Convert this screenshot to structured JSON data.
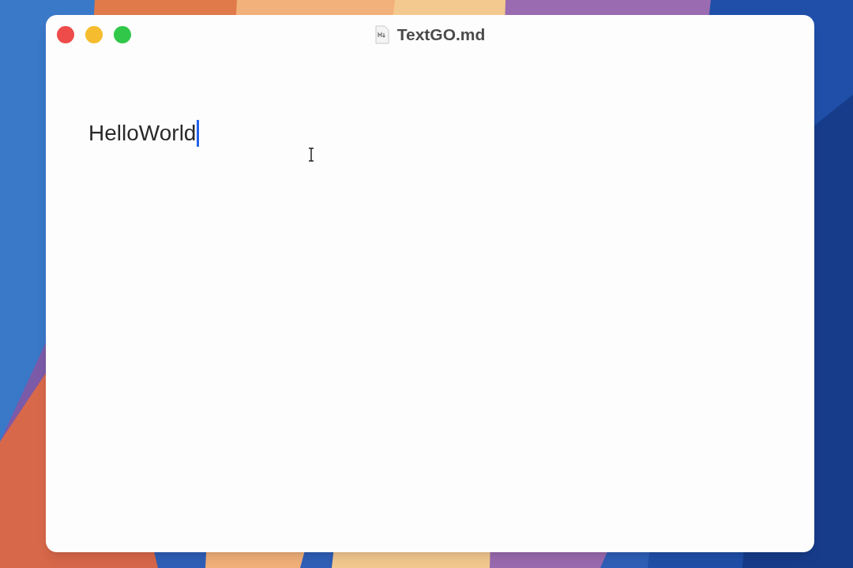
{
  "window": {
    "title": "TextGO.md"
  },
  "editor": {
    "text": "HelloWorld",
    "caret_visible": true
  }
}
